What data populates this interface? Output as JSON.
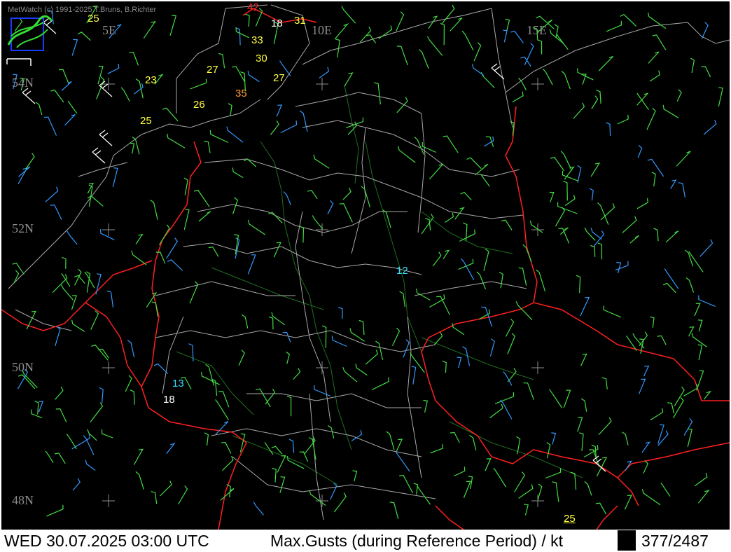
{
  "header": {
    "credit": "MetWatch  (c) 1991-2025 T.Bruns, B.Richter"
  },
  "grid_labels": {
    "lon_5e": "5E",
    "lon_10e": "10E",
    "lon_15e": "15E",
    "lat_54n": "54N",
    "lat_52n": "52N",
    "lat_50n": "50N",
    "lat_48n": "48N"
  },
  "gust_labels": [
    {
      "value": "42",
      "color": "#ff2a2a"
    },
    {
      "value": "25",
      "color": "#ffff44"
    },
    {
      "value": "18",
      "color": "#ffffff"
    },
    {
      "value": "31",
      "color": "#ffff44"
    },
    {
      "value": "33",
      "color": "#ffff44"
    },
    {
      "value": "30",
      "color": "#ffff44"
    },
    {
      "value": "27",
      "color": "#ffff44"
    },
    {
      "value": "23",
      "color": "#ffff44"
    },
    {
      "value": "27",
      "color": "#ffff44"
    },
    {
      "value": "35",
      "color": "#ff9933"
    },
    {
      "value": "26",
      "color": "#ffff44"
    },
    {
      "value": "25",
      "color": "#ffff44"
    },
    {
      "value": "12",
      "color": "#33ddff"
    },
    {
      "value": "13",
      "color": "#33ddff"
    },
    {
      "value": "18",
      "color": "#ffffff"
    },
    {
      "value": "25",
      "color": "#ffff44"
    }
  ],
  "status_bar": {
    "datetime": "WED 30.07.2025 03:00 UTC",
    "parameter": "Max.Gusts (during Reference Period) / kt",
    "count": "377/2487"
  },
  "colors": {
    "background": "#000000",
    "border_national": "#ff2020",
    "border_regional": "#a8a8a8",
    "rivers": "#1f6e1f",
    "barb_weak": "#44dd44",
    "barb_calm": "#3399ff",
    "barb_strong": "#ffffff"
  },
  "icons": {
    "logo": "metwatch-logo-icon"
  }
}
